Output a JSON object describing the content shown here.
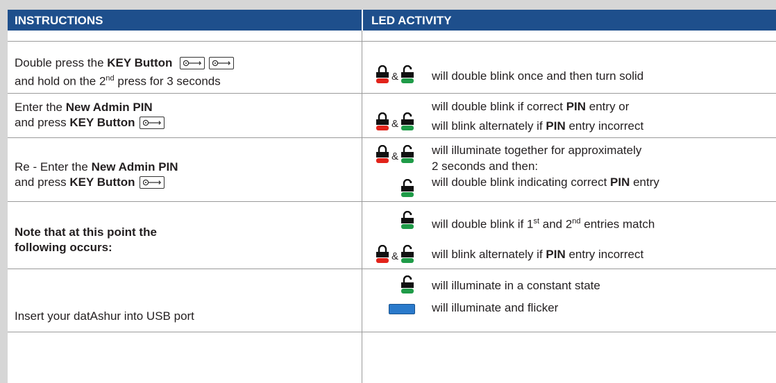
{
  "header": {
    "instructions": "INSTRUCTIONS",
    "led_activity": "LED ACTIVITY"
  },
  "rows": [
    {
      "instr_1a": "Double press the ",
      "instr_1b": "KEY Button",
      "instr_2a": "and hold on the 2",
      "instr_2sup": "nd",
      "instr_2b": " press for 3 seconds",
      "led_1": "will double blink once and then turn solid"
    },
    {
      "instr_1a": "Enter the ",
      "instr_1b": "New Admin PIN",
      "instr_2a": "and press ",
      "instr_2b": "KEY Button",
      "led_1a": "will double blink if correct ",
      "led_1b": "PIN",
      "led_1c": " entry or",
      "led_2a": "will blink alternately if ",
      "led_2b": "PIN",
      "led_2c": " entry incorrect"
    },
    {
      "instr_1a": "Re - Enter the ",
      "instr_1b": "New Admin PIN",
      "instr_2a": "and press ",
      "instr_2b": "KEY Button",
      "led_1": "will illuminate together for approximately",
      "led_2": "2 seconds and then:",
      "led_3a": "will double blink indicating correct ",
      "led_3b": "PIN",
      "led_3c": " entry"
    },
    {
      "instr_1": "Note that at this point the",
      "instr_2": "following occurs:",
      "led_1a": "will double blink if 1",
      "led_1sup1": "st",
      "led_1b": " and 2",
      "led_1sup2": "nd",
      "led_1c": " entries match",
      "led_2a": "will blink alternately if ",
      "led_2b": "PIN",
      "led_2c": " entry incorrect"
    },
    {
      "instr_1": "Insert your datAshur into USB port",
      "led_1": "will illuminate in a constant state",
      "led_2": "will illuminate and flicker"
    }
  ],
  "amp": "&",
  "colors": {
    "header_bg": "#1e4f8c",
    "red_led": "#e2231a",
    "green_led": "#1f9b48",
    "blue_led": "#2a7acb"
  }
}
